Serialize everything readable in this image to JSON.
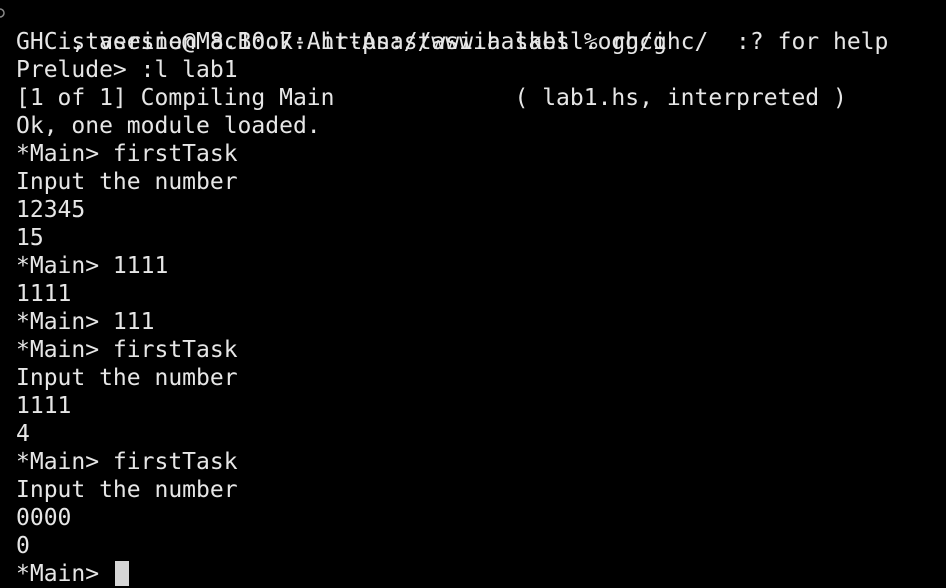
{
  "terminal": {
    "lines": [
      "staseine@MacBook-Air-Anastasiia labs % ghci",
      "GHCi, version 8.10.7: https://www.haskell.org/ghc/  :? for help",
      "Prelude> :l lab1",
      "[1 of 1] Compiling Main             ( lab1.hs, interpreted )",
      "Ok, one module loaded.",
      "*Main> firstTask",
      "Input the number",
      "12345",
      "15",
      "*Main> 1111",
      "1111",
      "*Main> 111",
      "*Main> firstTask",
      "Input the number",
      "1111",
      "4",
      "*Main> firstTask",
      "Input the number",
      "0000",
      "0"
    ],
    "prompt": "*Main> ",
    "prompt_mark_icon": "circle-prompt-marker-icon"
  }
}
